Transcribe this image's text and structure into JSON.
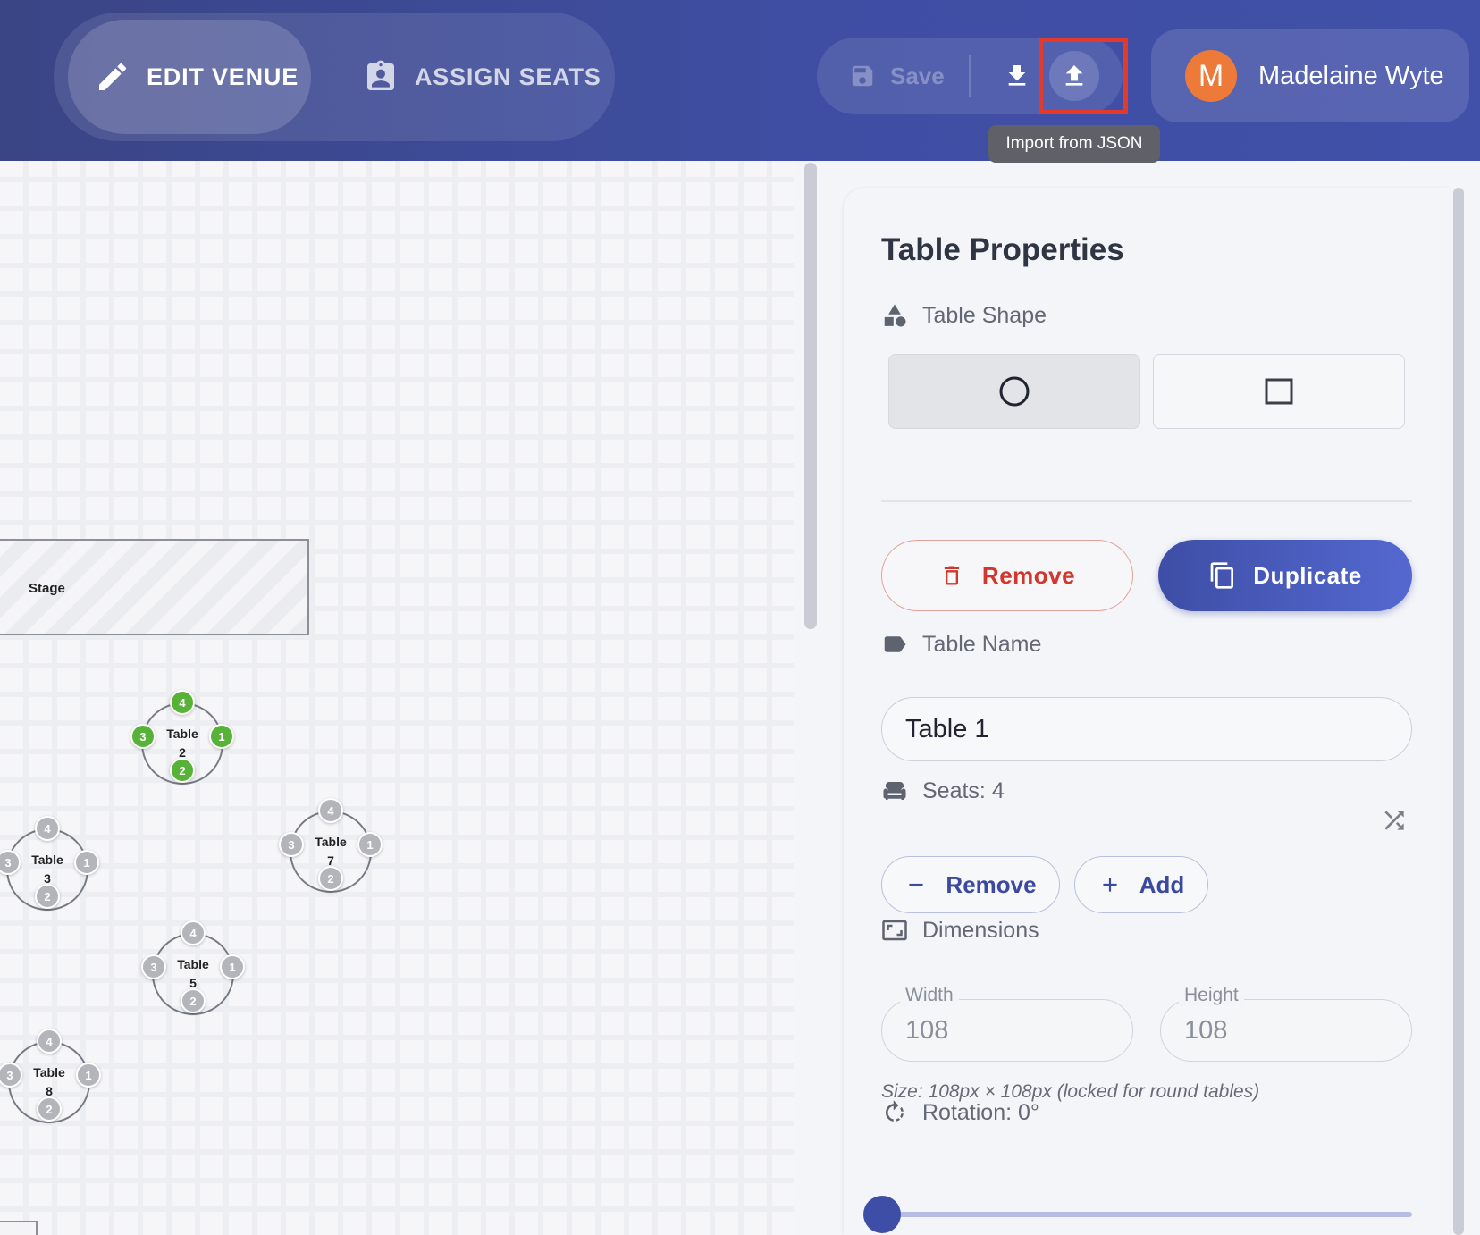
{
  "header": {
    "modes": [
      {
        "label": "EDIT VENUE",
        "active": true,
        "icon": "pencil-icon"
      },
      {
        "label": "ASSIGN SEATS",
        "active": false,
        "icon": "badge-icon"
      }
    ],
    "toolbar": {
      "save_label": "Save",
      "save_icon": "floppy-icon",
      "download_icon": "download-icon",
      "upload_icon": "upload-icon",
      "tooltip": "Import from JSON"
    },
    "user": {
      "initial": "M",
      "name": "Madelaine Wyte",
      "avatar_color": "#ee7a3a"
    }
  },
  "canvas": {
    "stage_label": "Stage",
    "tables": [
      {
        "name": "Table",
        "number": "2",
        "seats": [
          "4",
          "1",
          "2",
          "3"
        ],
        "seat_color": "green"
      },
      {
        "name": "Table",
        "number": "3",
        "seats": [
          "4",
          "1",
          "2",
          "3"
        ],
        "seat_color": "gray"
      },
      {
        "name": "Table",
        "number": "7",
        "seats": [
          "4",
          "1",
          "2",
          "3"
        ],
        "seat_color": "gray"
      },
      {
        "name": "Table",
        "number": "5",
        "seats": [
          "4",
          "1",
          "2",
          "3"
        ],
        "seat_color": "gray"
      },
      {
        "name": "Table",
        "number": "8",
        "seats": [
          "4",
          "1",
          "2",
          "3"
        ],
        "seat_color": "gray"
      }
    ]
  },
  "panel": {
    "title": "Table Properties",
    "shape": {
      "label": "Table Shape",
      "options": [
        "circle",
        "square"
      ],
      "selected": "circle"
    },
    "actions": {
      "remove": "Remove",
      "duplicate": "Duplicate"
    },
    "name": {
      "label": "Table Name",
      "value": "Table 1"
    },
    "seats": {
      "label": "Seats: 4",
      "remove": "Remove",
      "add": "Add"
    },
    "dimensions": {
      "label": "Dimensions",
      "width_label": "Width",
      "width_value": "108",
      "height_label": "Height",
      "height_value": "108",
      "note": "Size: 108px × 108px (locked for round tables)"
    },
    "rotation": {
      "label": "Rotation: 0°",
      "value_deg": 0
    }
  },
  "colors": {
    "accent": "#3e4ea6",
    "danger": "#d0382e",
    "seat_green": "#57b338",
    "highlight": "#e23b2e"
  }
}
